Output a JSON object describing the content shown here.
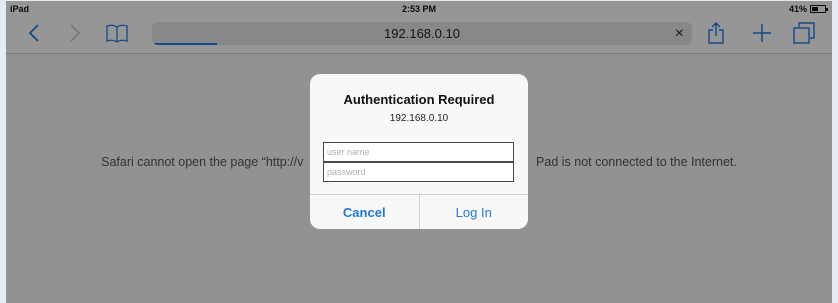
{
  "status_bar": {
    "device": "iPad",
    "time": "2:53 PM",
    "battery_percent": "41%",
    "battery_level": 0.41
  },
  "toolbar": {
    "address": "192.168.0.10",
    "clear_icon": "×",
    "load_progress": 0.12,
    "icons": [
      "chevron-left-icon",
      "chevron-right-icon",
      "book-icon",
      "share-icon",
      "plus-icon",
      "tabs-icon"
    ]
  },
  "page": {
    "error_text": "Safari cannot open the page “http://v                                                                   Pad is not connected to the Internet."
  },
  "dialog": {
    "title": "Authentication Required",
    "host": "192.168.0.10",
    "username_placeholder": "user name",
    "password_placeholder": "password",
    "username_value": "",
    "password_value": "",
    "cancel_label": "Cancel",
    "login_label": "Log In"
  },
  "colors": {
    "accent": "#1f7ae0",
    "dim_overlay": "rgba(0,0,0,0.4)"
  }
}
